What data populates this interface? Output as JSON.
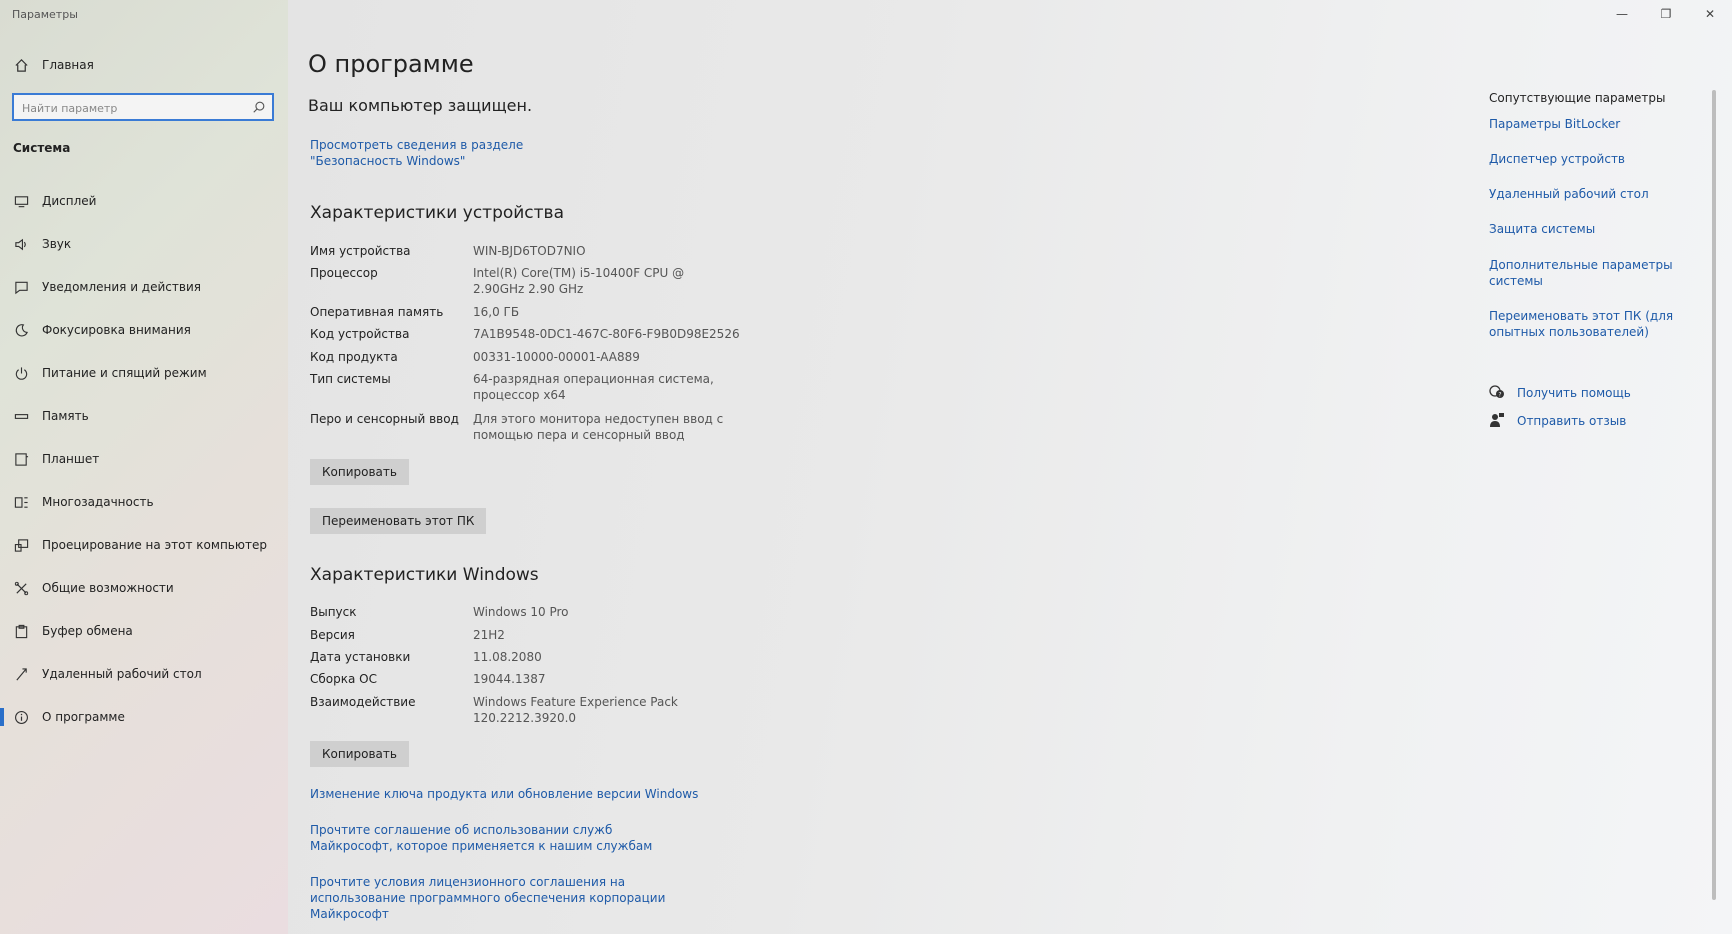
{
  "window": {
    "title": "Параметры",
    "controls": {
      "minimize": "—",
      "maximize": "❐",
      "close": "✕"
    }
  },
  "sidebar": {
    "home_label": "Главная",
    "search_placeholder": "Найти параметр",
    "section_label": "Система",
    "items": [
      {
        "label": "Дисплей",
        "icon": "display-icon"
      },
      {
        "label": "Звук",
        "icon": "sound-icon"
      },
      {
        "label": "Уведомления и действия",
        "icon": "notifications-icon"
      },
      {
        "label": "Фокусировка внимания",
        "icon": "focus-assist-icon"
      },
      {
        "label": "Питание и спящий режим",
        "icon": "power-icon"
      },
      {
        "label": "Память",
        "icon": "storage-icon"
      },
      {
        "label": "Планшет",
        "icon": "tablet-icon"
      },
      {
        "label": "Многозадачность",
        "icon": "multitasking-icon"
      },
      {
        "label": "Проецирование на этот компьютер",
        "icon": "projecting-icon"
      },
      {
        "label": "Общие возможности",
        "icon": "shared-experiences-icon"
      },
      {
        "label": "Буфер обмена",
        "icon": "clipboard-icon"
      },
      {
        "label": "Удаленный рабочий стол",
        "icon": "remote-desktop-icon"
      },
      {
        "label": "О программе",
        "icon": "info-icon",
        "active": true
      }
    ]
  },
  "main": {
    "title": "О программе",
    "protected_text": "Ваш компьютер защищен.",
    "security_link": "Просмотреть сведения в разделе \"Безопасность Windows\"",
    "device_heading": "Характеристики устройства",
    "device_specs": [
      {
        "label": "Имя устройства",
        "value": "WIN-BJD6TOD7NIO"
      },
      {
        "label": "Процессор",
        "value": "Intel(R) Core(TM) i5-10400F CPU @ 2.90GHz   2.90 GHz"
      },
      {
        "label": "Оперативная память",
        "value": "16,0 ГБ"
      },
      {
        "label": "Код устройства",
        "value": "7A1B9548-0DC1-467C-80F6-F9B0D98E2526"
      },
      {
        "label": "Код продукта",
        "value": "00331-10000-00001-AA889"
      },
      {
        "label": "Тип системы",
        "value": "64-разрядная операционная система, процессор x64"
      },
      {
        "label": "Перо и сенсорный ввод",
        "value": "Для этого монитора недоступен ввод с помощью пера и сенсорный ввод"
      }
    ],
    "copy_label": "Копировать",
    "rename_label": "Переименовать этот ПК",
    "windows_heading": "Характеристики Windows",
    "windows_specs": [
      {
        "label": "Выпуск",
        "value": "Windows 10 Pro"
      },
      {
        "label": "Версия",
        "value": "21H2"
      },
      {
        "label": "Дата установки",
        "value": "11.08.2080"
      },
      {
        "label": "Сборка ОС",
        "value": "19044.1387"
      },
      {
        "label": "Взаимодействие",
        "value": "Windows Feature Experience Pack 120.2212.3920.0"
      }
    ],
    "copy_windows_label": "Копировать",
    "change_key_link": "Изменение ключа продукта или обновление версии Windows",
    "services_link": "Прочтите соглашение об использовании служб Майкрософт, которое применяется к нашим службам",
    "license_link": "Прочтите условия лицензионного соглашения на использование программного обеспечения корпорации Майкрософт"
  },
  "related": {
    "heading": "Сопутствующие параметры",
    "links": [
      "Параметры BitLocker",
      "Диспетчер устройств",
      "Удаленный рабочий стол",
      "Защита системы",
      "Дополнительные параметры системы",
      "Переименовать этот ПК (для опытных пользователей)"
    ],
    "help": [
      {
        "label": "Получить помощь",
        "icon": "get-help-icon"
      },
      {
        "label": "Отправить отзыв",
        "icon": "feedback-icon"
      }
    ]
  },
  "colors": {
    "accent": "#2a6fc9",
    "link": "#1e5aa8",
    "button": "#cfcfcf"
  }
}
